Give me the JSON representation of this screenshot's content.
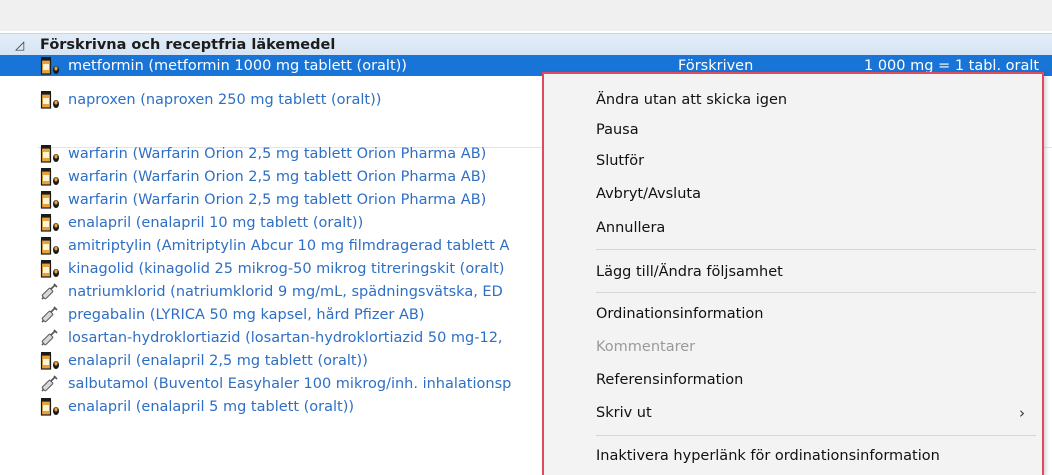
{
  "group": {
    "toggle_glyph": "◿",
    "title": "Förskrivna och receptfria läkemedel"
  },
  "rows": [
    {
      "icon": "pill-bottle-icon",
      "name": "metformin (metformin 1000 mg tablett (oralt))",
      "status": "Förskriven",
      "dose": "1 000 mg = 1 tabl. oralt",
      "selected": true
    },
    {
      "icon": "pill-bottle-icon",
      "name": "naproxen (naproxen 250 mg tablett (oralt))"
    },
    {
      "icon": "pill-bottle-icon",
      "name": "warfarin (Warfarin Orion 2,5 mg tablett Orion Pharma AB)"
    },
    {
      "icon": "pill-bottle-icon",
      "name": "warfarin (Warfarin Orion 2,5 mg tablett Orion Pharma AB)"
    },
    {
      "icon": "pill-bottle-icon",
      "name": "warfarin (Warfarin Orion 2,5 mg tablett Orion Pharma AB)"
    },
    {
      "icon": "pill-bottle-icon",
      "name": "enalapril (enalapril 10 mg tablett (oralt))"
    },
    {
      "icon": "pill-bottle-icon",
      "name": "amitriptylin (Amitriptylin Abcur 10 mg filmdragerad tablett A"
    },
    {
      "icon": "pill-bottle-icon",
      "name": "kinagolid (kinagolid 25 mikrog-50 mikrog titreringskit (oralt)"
    },
    {
      "icon": "syringe-icon",
      "name": "natriumklorid (natriumklorid 9 mg/mL, spädningsvätska, ED"
    },
    {
      "icon": "syringe-icon",
      "name": "pregabalin (LYRICA 50 mg kapsel, hård Pfizer AB)"
    },
    {
      "icon": "syringe-icon",
      "name": "losartan-hydroklortiazid (losartan-hydroklortiazid 50 mg-12,"
    },
    {
      "icon": "pill-bottle-icon",
      "name": "enalapril (enalapril 2,5 mg tablett (oralt))"
    },
    {
      "icon": "syringe-icon",
      "name": "salbutamol (Buventol Easyhaler 100 mikrog/inh. inhalationsp"
    },
    {
      "icon": "pill-bottle-icon",
      "name": "enalapril (enalapril 5 mg tablett (oralt))"
    }
  ],
  "context_menu": {
    "items": [
      {
        "label": "Ändra utan att skicka igen"
      },
      {
        "label": "Pausa"
      },
      {
        "label": "Slutför"
      },
      {
        "label": "Avbryt/Avsluta"
      },
      {
        "label": "Annullera"
      },
      {
        "label": "Lägg till/Ändra följsamhet"
      },
      {
        "label": "Ordinationsinformation"
      },
      {
        "label": "Kommentarer",
        "disabled": true
      },
      {
        "label": "Referensinformation"
      },
      {
        "label": "Skriv ut",
        "submenu_glyph": "›"
      },
      {
        "label": "Inaktivera hyperlänk för ordinationsinformation"
      }
    ]
  },
  "colors": {
    "link": "#2e6fc4",
    "selection": "#1874d6",
    "group_header": "#dce8f5",
    "menu_border": "#e04a5e",
    "menu_background": "#f3f3f3"
  }
}
